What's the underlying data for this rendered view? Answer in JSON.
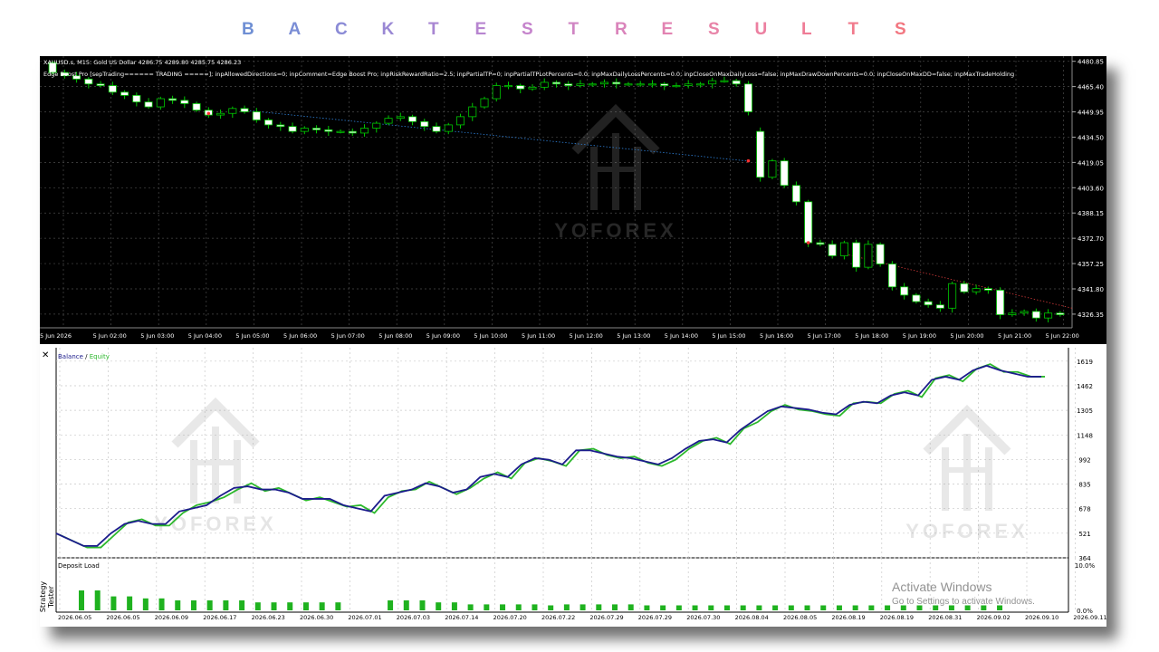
{
  "title": {
    "letters": [
      "B",
      "A",
      "C",
      "K",
      "T",
      "E",
      "S",
      "T",
      "R",
      "E",
      "S",
      "U",
      "L",
      "T",
      "S"
    ],
    "colors": [
      "#6f8fd4",
      "#7b8ed6",
      "#8b8bd6",
      "#9a88d4",
      "#a886d2",
      "#b785d0",
      "#c584cc",
      "#d085c3",
      "#da84bb",
      "#e283b2",
      "#e884a8",
      "#ec7fa0",
      "#ef7c96",
      "#f17a8c",
      "#f27781"
    ]
  },
  "price_chart": {
    "symbol_line": "XAUUSD.s, M15:  Gold US Dollar  4286.75 4289.80 4285.75 4286.23",
    "params_line": "Edge Boost Pro [sepTrading====== TRADING =====]; inpAllowedDirections=0; inpComment=Edge Boost Pro; inpRiskRewardRatio=2.5; inpPartialTP=0; inpPartialTPLotPercents=0.0; inpMaxDailyLossPercents=0.0; inpCloseOnMaxDailyLoss=false; inpMaxDrawDownPercents=0.0; inpCloseOnMaxDD=false; inpMaxTradeHolding",
    "background": "#000000",
    "grid_color": "#4a4a4a",
    "candle_bull": "#000000",
    "candle_bear": "#ffffff",
    "wick_color": "#00c800",
    "marker_color": "#ff3030",
    "dotted_line_color": "#2e7fd6",
    "dotted_line2_color": "#d23a3a",
    "watermark": "YOFOREX"
  },
  "chart_data": [
    {
      "type": "candlestick",
      "title": "",
      "ylim": [
        4318,
        4484
      ],
      "y_ticks": [
        "4480.85",
        "4465.40",
        "4449.95",
        "4434.50",
        "4419.05",
        "4403.60",
        "4388.15",
        "4372.70",
        "4357.25",
        "4341.80",
        "4326.35"
      ],
      "x_ticks": [
        "5 Jun 2026",
        "5 Jun 02:00",
        "5 Jun 03:00",
        "5 Jun 04:00",
        "5 Jun 05:00",
        "5 Jun 06:00",
        "5 Jun 07:00",
        "5 Jun 08:00",
        "5 Jun 09:00",
        "5 Jun 10:00",
        "5 Jun 11:00",
        "5 Jun 12:00",
        "5 Jun 13:00",
        "5 Jun 14:00",
        "5 Jun 15:00",
        "5 Jun 16:00",
        "5 Jun 17:00",
        "5 Jun 18:00",
        "5 Jun 19:00",
        "5 Jun 20:00",
        "5 Jun 21:00",
        "5 Jun 22:00"
      ],
      "close": [
        4474,
        4472,
        4470,
        4467,
        4466,
        4462,
        4460,
        4456,
        4453,
        4458,
        4457,
        4455,
        4451,
        4448,
        4449,
        4452,
        4450,
        4445,
        4442,
        4441,
        4438,
        4440,
        4439,
        4438,
        4438,
        4437,
        4440,
        4443,
        4446,
        4447,
        4444,
        4441,
        4438,
        4442,
        4447,
        4453,
        4458,
        4466,
        4466,
        4464,
        4465,
        4468,
        4467,
        4466,
        4467,
        4467,
        4468,
        4467,
        4467,
        4467,
        4467,
        4466,
        4466,
        4467,
        4467,
        4469,
        4469,
        4467,
        4450,
        4410,
        4420,
        4405,
        4395,
        4370,
        4369,
        4362,
        4370,
        4355,
        4369,
        4357,
        4343,
        4338,
        4334,
        4332,
        4330,
        4345,
        4340,
        4342,
        4341,
        4326,
        4327,
        4328,
        4324,
        4327,
        4326
      ],
      "open": [
        4480,
        4474,
        4472,
        4470,
        4467,
        4466,
        4462,
        4460,
        4456,
        4453,
        4458,
        4457,
        4455,
        4451,
        4448,
        4449,
        4452,
        4450,
        4445,
        4442,
        4441,
        4438,
        4440,
        4439,
        4438,
        4438,
        4437,
        4440,
        4443,
        4446,
        4447,
        4444,
        4441,
        4438,
        4442,
        4447,
        4453,
        4458,
        4466,
        4466,
        4464,
        4465,
        4468,
        4467,
        4466,
        4467,
        4467,
        4468,
        4467,
        4467,
        4467,
        4467,
        4466,
        4466,
        4467,
        4467,
        4469,
        4469,
        4467,
        4438,
        4410,
        4420,
        4405,
        4395,
        4370,
        4369,
        4362,
        4370,
        4355,
        4369,
        4357,
        4343,
        4338,
        4334,
        4332,
        4330,
        4345,
        4340,
        4342,
        4341,
        4326,
        4327,
        4328,
        4324,
        4327
      ]
    },
    {
      "type": "line",
      "title": "",
      "series": [
        {
          "name": "Balance",
          "color": "#1c1c8c",
          "values": [
            520,
            480,
            440,
            440,
            520,
            580,
            600,
            580,
            580,
            660,
            680,
            700,
            760,
            810,
            820,
            800,
            800,
            780,
            740,
            740,
            740,
            700,
            680,
            660,
            760,
            780,
            800,
            840,
            820,
            780,
            800,
            880,
            900,
            880,
            960,
            1000,
            990,
            960,
            1050,
            1050,
            1030,
            1010,
            1000,
            980,
            960,
            1000,
            1060,
            1110,
            1120,
            1100,
            1180,
            1240,
            1300,
            1330,
            1320,
            1310,
            1290,
            1280,
            1340,
            1360,
            1350,
            1400,
            1420,
            1400,
            1500,
            1520,
            1500,
            1560,
            1590,
            1560,
            1540,
            1520,
            1520
          ]
        },
        {
          "name": "Equity",
          "color": "#2cb82c",
          "values": [
            510,
            470,
            430,
            430,
            510,
            590,
            610,
            570,
            570,
            650,
            700,
            720,
            750,
            800,
            840,
            790,
            810,
            770,
            730,
            750,
            720,
            690,
            700,
            650,
            750,
            790,
            800,
            850,
            810,
            770,
            810,
            870,
            910,
            870,
            970,
            1000,
            980,
            950,
            1050,
            1060,
            1020,
            1000,
            1010,
            970,
            950,
            990,
            1060,
            1110,
            1130,
            1090,
            1190,
            1230,
            1300,
            1340,
            1310,
            1300,
            1280,
            1270,
            1350,
            1360,
            1350,
            1410,
            1430,
            1390,
            1510,
            1530,
            1490,
            1570,
            1600,
            1550,
            1550,
            1520,
            1520
          ]
        }
      ],
      "ylim": [
        364,
        1670
      ],
      "y_ticks": [
        "1619",
        "1462",
        "1305",
        "1148",
        "992",
        "835",
        "678",
        "521",
        "364"
      ],
      "legend": "top-left"
    },
    {
      "type": "bar",
      "title": "Deposit Load",
      "y_ticks": [
        "10.0%",
        "0.0%"
      ],
      "x_ticks": [
        "2026.06.05",
        "2026.06.05",
        "2026.06.09",
        "2026.06.17",
        "2026.06.23",
        "2026.06.30",
        "2026.07.01",
        "2026.07.03",
        "2026.07.14",
        "2026.07.20",
        "2026.07.22",
        "2026.07.29",
        "2026.07.29",
        "2026.07.30",
        "2026.08.04",
        "2026.08.05",
        "2026.08.19",
        "2026.08.19",
        "2026.08.31",
        "2026.09.02",
        "2026.09.10",
        "2026.09.11"
      ],
      "values": [
        2.0,
        2.0,
        1.4,
        1.4,
        1.2,
        1.2,
        1.0,
        1.0,
        1.0,
        1.0,
        1.0,
        0.8,
        0.8,
        0.8,
        0.8,
        0.8,
        0.8,
        1.0,
        1.0,
        1.0,
        0.8,
        0.8,
        0.6,
        0.6,
        0.6,
        0.6,
        0.6,
        0.5,
        0.6,
        0.6,
        0.6,
        0.6,
        0.6,
        0.5,
        0.5,
        0.5,
        0.5,
        0.5,
        0.5,
        0.5,
        0.5,
        0.5,
        0.5,
        0.5,
        0.5,
        0.5,
        0.5,
        0.5,
        0.5,
        0.5,
        0.5,
        0.5,
        0.5,
        0.5,
        0.5,
        0.5
      ]
    }
  ],
  "equity_panel": {
    "legend_balance": "Balance",
    "legend_sep": " / ",
    "legend_equity": "Equity",
    "balance_color": "#1c1c8c",
    "equity_color": "#2cb82c",
    "deposit_label": "Deposit Load",
    "bar_color": "#1fb21f",
    "side_label": "Strategy Tester",
    "close_glyph": "✕"
  },
  "activate": {
    "line1": "Activate Windows",
    "line2": "Go to Settings to activate Windows."
  }
}
